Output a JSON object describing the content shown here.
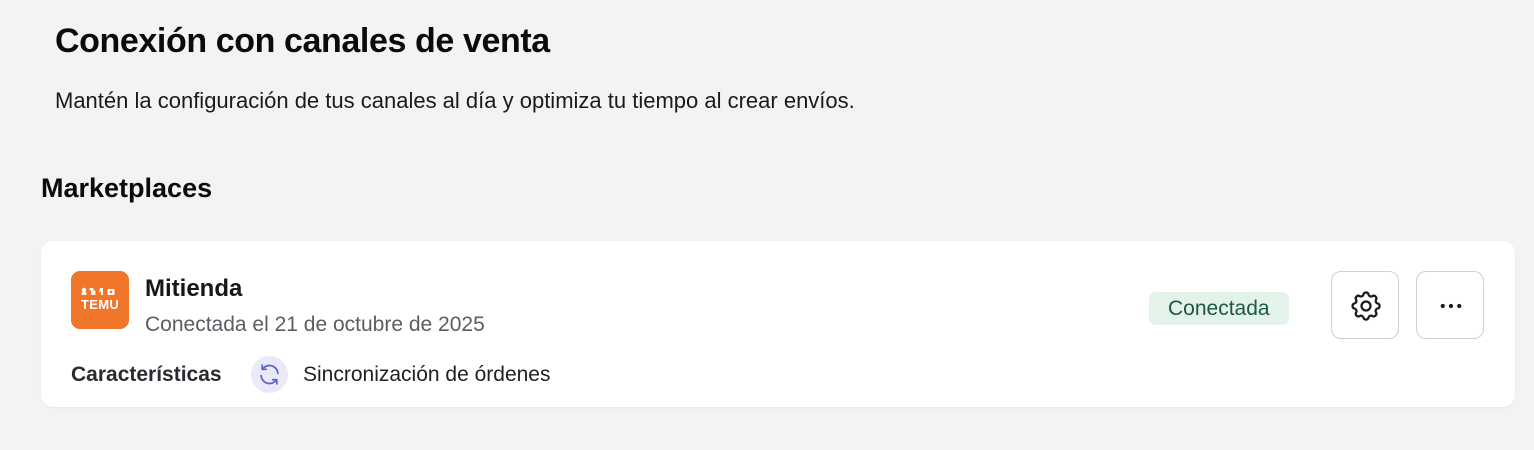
{
  "header": {
    "title": "Conexión con canales de venta",
    "subtitle": "Mantén la configuración de tus canales al día y optimiza tu tiempo al crear envíos."
  },
  "section": {
    "title": "Marketplaces"
  },
  "channel": {
    "logo_text": "TEMU",
    "logo_icon": "temu-logo-icon",
    "name": "Mitienda",
    "connected_date": "Conectada el 21 de octubre de 2025",
    "status": "Conectada",
    "features_label": "Características",
    "features": [
      {
        "icon": "sync-icon",
        "label": "Sincronización de órdenes"
      }
    ],
    "actions": {
      "settings_icon": "gear-icon",
      "more_icon": "more-horizontal-icon"
    }
  },
  "colors": {
    "background": "#f3f3f5",
    "card": "#ffffff",
    "brand_orange": "#f0762a",
    "status_bg": "#e3f3ea",
    "status_text": "#1d5a3c",
    "sync_icon_bg": "#e9e9f8",
    "sync_icon_stroke": "#5b5fc7"
  }
}
